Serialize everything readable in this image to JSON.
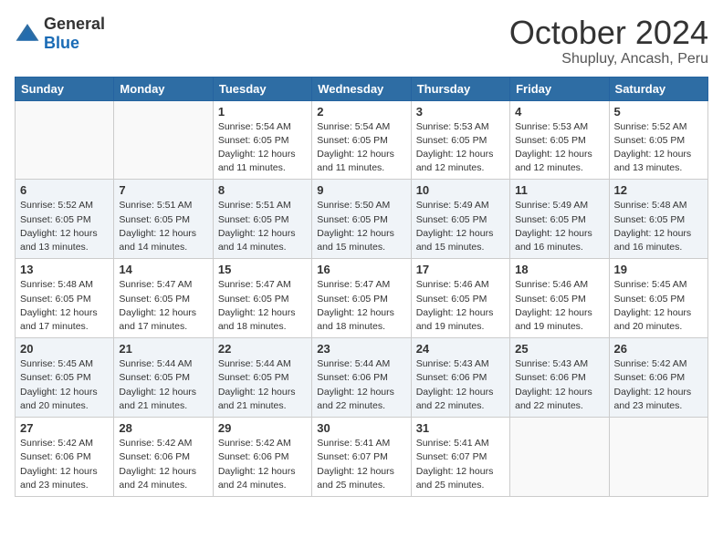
{
  "logo": {
    "general": "General",
    "blue": "Blue"
  },
  "title": "October 2024",
  "location": "Shupluy, Ancash, Peru",
  "days_of_week": [
    "Sunday",
    "Monday",
    "Tuesday",
    "Wednesday",
    "Thursday",
    "Friday",
    "Saturday"
  ],
  "weeks": [
    [
      {
        "day": "",
        "empty": true
      },
      {
        "day": "",
        "empty": true
      },
      {
        "day": "1",
        "sunrise": "Sunrise: 5:54 AM",
        "sunset": "Sunset: 6:05 PM",
        "daylight": "Daylight: 12 hours and 11 minutes."
      },
      {
        "day": "2",
        "sunrise": "Sunrise: 5:54 AM",
        "sunset": "Sunset: 6:05 PM",
        "daylight": "Daylight: 12 hours and 11 minutes."
      },
      {
        "day": "3",
        "sunrise": "Sunrise: 5:53 AM",
        "sunset": "Sunset: 6:05 PM",
        "daylight": "Daylight: 12 hours and 12 minutes."
      },
      {
        "day": "4",
        "sunrise": "Sunrise: 5:53 AM",
        "sunset": "Sunset: 6:05 PM",
        "daylight": "Daylight: 12 hours and 12 minutes."
      },
      {
        "day": "5",
        "sunrise": "Sunrise: 5:52 AM",
        "sunset": "Sunset: 6:05 PM",
        "daylight": "Daylight: 12 hours and 13 minutes."
      }
    ],
    [
      {
        "day": "6",
        "sunrise": "Sunrise: 5:52 AM",
        "sunset": "Sunset: 6:05 PM",
        "daylight": "Daylight: 12 hours and 13 minutes."
      },
      {
        "day": "7",
        "sunrise": "Sunrise: 5:51 AM",
        "sunset": "Sunset: 6:05 PM",
        "daylight": "Daylight: 12 hours and 14 minutes."
      },
      {
        "day": "8",
        "sunrise": "Sunrise: 5:51 AM",
        "sunset": "Sunset: 6:05 PM",
        "daylight": "Daylight: 12 hours and 14 minutes."
      },
      {
        "day": "9",
        "sunrise": "Sunrise: 5:50 AM",
        "sunset": "Sunset: 6:05 PM",
        "daylight": "Daylight: 12 hours and 15 minutes."
      },
      {
        "day": "10",
        "sunrise": "Sunrise: 5:49 AM",
        "sunset": "Sunset: 6:05 PM",
        "daylight": "Daylight: 12 hours and 15 minutes."
      },
      {
        "day": "11",
        "sunrise": "Sunrise: 5:49 AM",
        "sunset": "Sunset: 6:05 PM",
        "daylight": "Daylight: 12 hours and 16 minutes."
      },
      {
        "day": "12",
        "sunrise": "Sunrise: 5:48 AM",
        "sunset": "Sunset: 6:05 PM",
        "daylight": "Daylight: 12 hours and 16 minutes."
      }
    ],
    [
      {
        "day": "13",
        "sunrise": "Sunrise: 5:48 AM",
        "sunset": "Sunset: 6:05 PM",
        "daylight": "Daylight: 12 hours and 17 minutes."
      },
      {
        "day": "14",
        "sunrise": "Sunrise: 5:47 AM",
        "sunset": "Sunset: 6:05 PM",
        "daylight": "Daylight: 12 hours and 17 minutes."
      },
      {
        "day": "15",
        "sunrise": "Sunrise: 5:47 AM",
        "sunset": "Sunset: 6:05 PM",
        "daylight": "Daylight: 12 hours and 18 minutes."
      },
      {
        "day": "16",
        "sunrise": "Sunrise: 5:47 AM",
        "sunset": "Sunset: 6:05 PM",
        "daylight": "Daylight: 12 hours and 18 minutes."
      },
      {
        "day": "17",
        "sunrise": "Sunrise: 5:46 AM",
        "sunset": "Sunset: 6:05 PM",
        "daylight": "Daylight: 12 hours and 19 minutes."
      },
      {
        "day": "18",
        "sunrise": "Sunrise: 5:46 AM",
        "sunset": "Sunset: 6:05 PM",
        "daylight": "Daylight: 12 hours and 19 minutes."
      },
      {
        "day": "19",
        "sunrise": "Sunrise: 5:45 AM",
        "sunset": "Sunset: 6:05 PM",
        "daylight": "Daylight: 12 hours and 20 minutes."
      }
    ],
    [
      {
        "day": "20",
        "sunrise": "Sunrise: 5:45 AM",
        "sunset": "Sunset: 6:05 PM",
        "daylight": "Daylight: 12 hours and 20 minutes."
      },
      {
        "day": "21",
        "sunrise": "Sunrise: 5:44 AM",
        "sunset": "Sunset: 6:05 PM",
        "daylight": "Daylight: 12 hours and 21 minutes."
      },
      {
        "day": "22",
        "sunrise": "Sunrise: 5:44 AM",
        "sunset": "Sunset: 6:05 PM",
        "daylight": "Daylight: 12 hours and 21 minutes."
      },
      {
        "day": "23",
        "sunrise": "Sunrise: 5:44 AM",
        "sunset": "Sunset: 6:06 PM",
        "daylight": "Daylight: 12 hours and 22 minutes."
      },
      {
        "day": "24",
        "sunrise": "Sunrise: 5:43 AM",
        "sunset": "Sunset: 6:06 PM",
        "daylight": "Daylight: 12 hours and 22 minutes."
      },
      {
        "day": "25",
        "sunrise": "Sunrise: 5:43 AM",
        "sunset": "Sunset: 6:06 PM",
        "daylight": "Daylight: 12 hours and 22 minutes."
      },
      {
        "day": "26",
        "sunrise": "Sunrise: 5:42 AM",
        "sunset": "Sunset: 6:06 PM",
        "daylight": "Daylight: 12 hours and 23 minutes."
      }
    ],
    [
      {
        "day": "27",
        "sunrise": "Sunrise: 5:42 AM",
        "sunset": "Sunset: 6:06 PM",
        "daylight": "Daylight: 12 hours and 23 minutes."
      },
      {
        "day": "28",
        "sunrise": "Sunrise: 5:42 AM",
        "sunset": "Sunset: 6:06 PM",
        "daylight": "Daylight: 12 hours and 24 minutes."
      },
      {
        "day": "29",
        "sunrise": "Sunrise: 5:42 AM",
        "sunset": "Sunset: 6:06 PM",
        "daylight": "Daylight: 12 hours and 24 minutes."
      },
      {
        "day": "30",
        "sunrise": "Sunrise: 5:41 AM",
        "sunset": "Sunset: 6:07 PM",
        "daylight": "Daylight: 12 hours and 25 minutes."
      },
      {
        "day": "31",
        "sunrise": "Sunrise: 5:41 AM",
        "sunset": "Sunset: 6:07 PM",
        "daylight": "Daylight: 12 hours and 25 minutes."
      },
      {
        "day": "",
        "empty": true
      },
      {
        "day": "",
        "empty": true
      }
    ]
  ]
}
